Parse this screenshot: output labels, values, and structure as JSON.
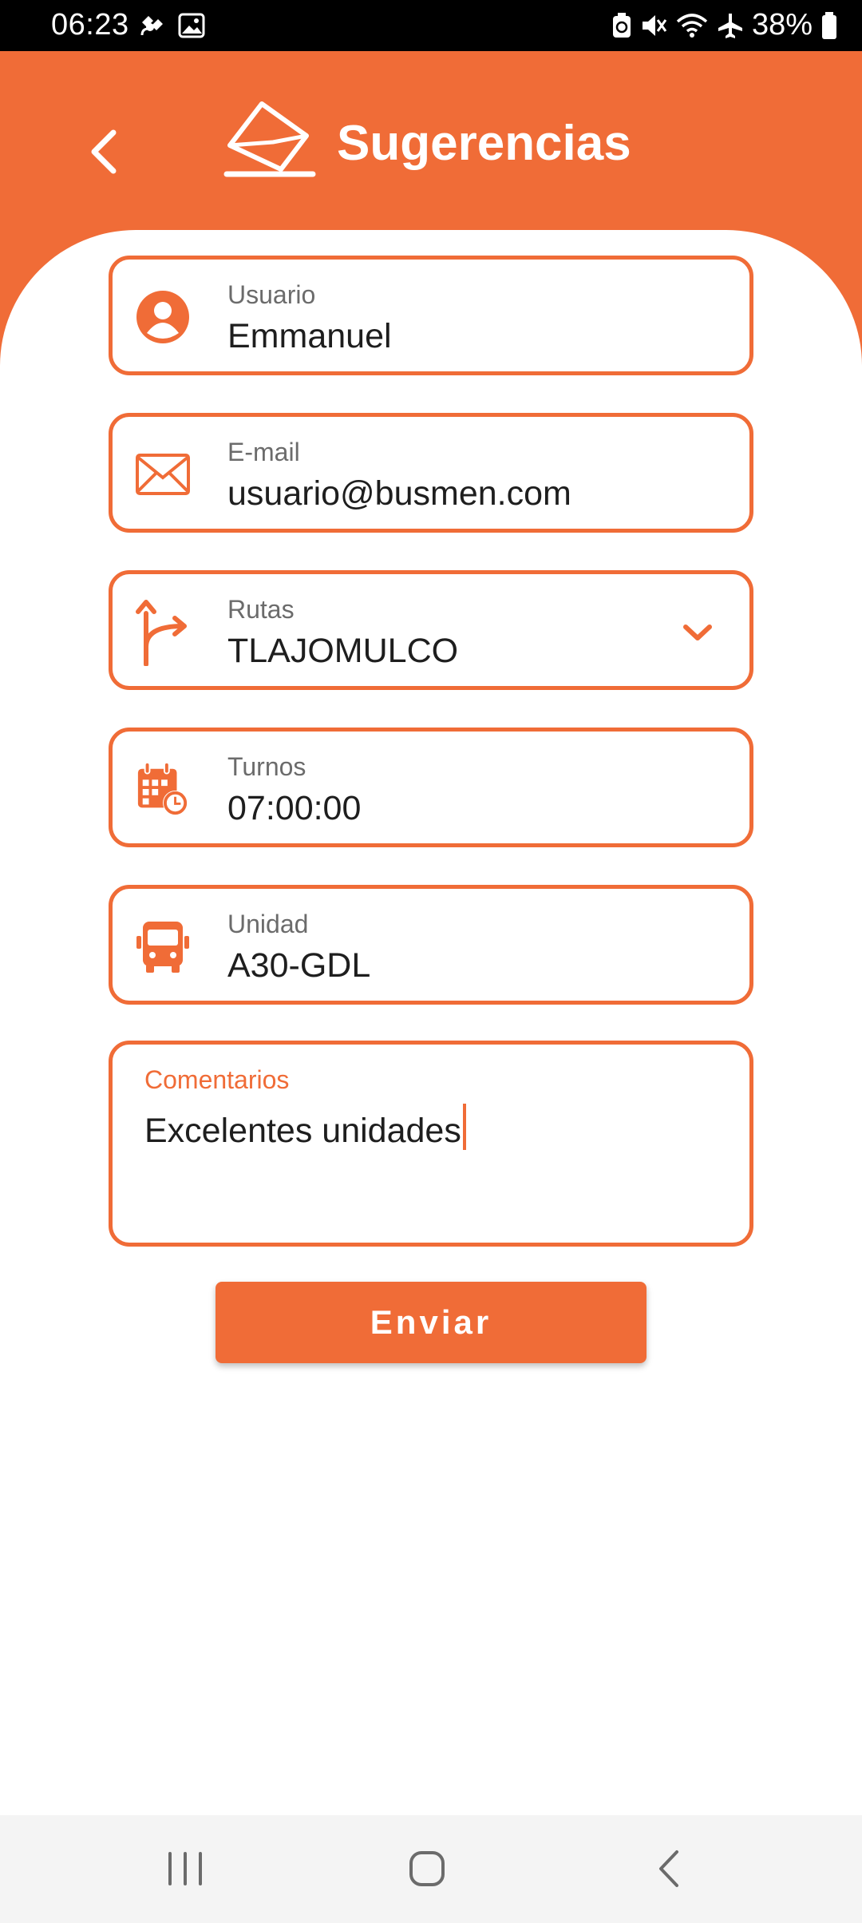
{
  "status_bar": {
    "time": "06:23",
    "battery": "38%"
  },
  "header": {
    "title": "Sugerencias",
    "accent_color": "#F06C37"
  },
  "form": {
    "user": {
      "label": "Usuario",
      "value": "Emmanuel",
      "icon": "person-icon"
    },
    "email": {
      "label": "E-mail",
      "value": "usuario@busmen.com",
      "icon": "mail-icon"
    },
    "routes": {
      "label": "Rutas",
      "value": "TLAJOMULCO",
      "icon": "route-fork-icon"
    },
    "shifts": {
      "label": "Turnos",
      "value": "07:00:00",
      "icon": "calendar-clock-icon"
    },
    "unit": {
      "label": "Unidad",
      "value": "A30-GDL",
      "icon": "bus-icon"
    },
    "comments": {
      "label": "Comentarios",
      "value": "Excelentes unidades"
    },
    "submit_label": "Enviar"
  }
}
